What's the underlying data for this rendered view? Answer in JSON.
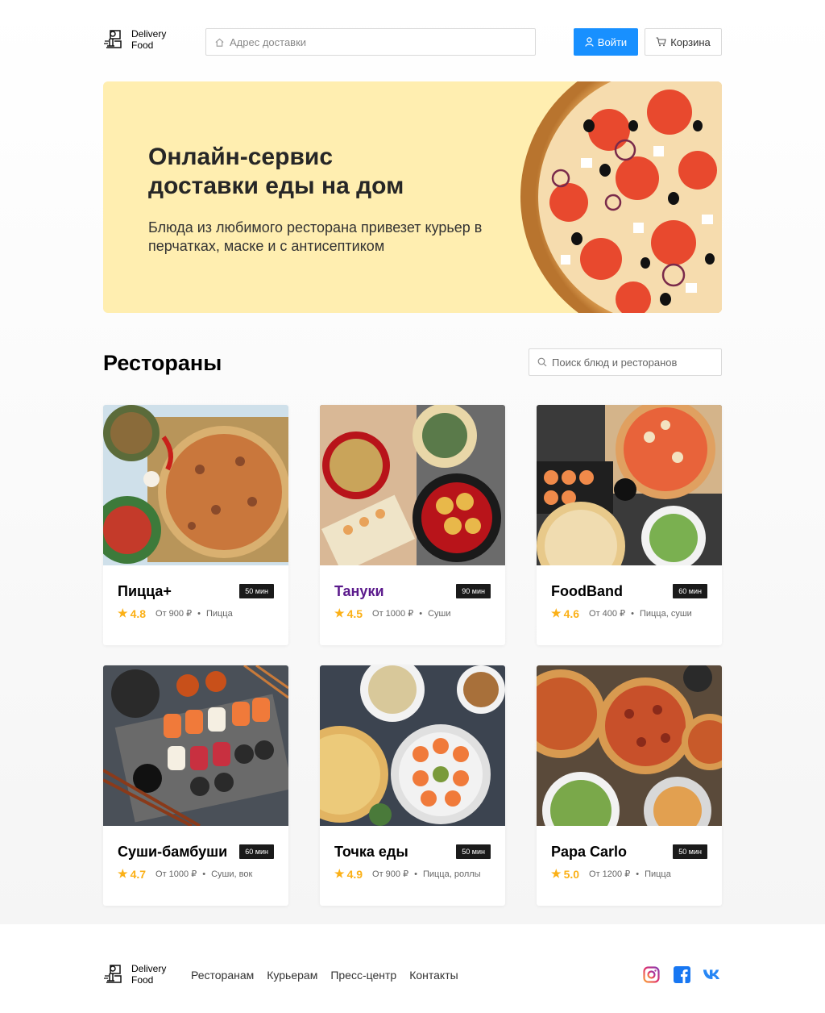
{
  "header": {
    "logo_line1": "Delivery",
    "logo_line2": "Food",
    "address_placeholder": "Адрес доставки",
    "login_label": "Войти",
    "cart_label": "Корзина"
  },
  "promo": {
    "title": "Онлайн-сервис доставки еды на дом",
    "text": "Блюда из любимого ресторана привезет курьер в перчатках, маске и с антисептиком"
  },
  "section": {
    "title": "Рестораны",
    "search_placeholder": "Поиск блюд и ресторанов"
  },
  "restaurants": [
    {
      "name": "Пицца+",
      "time": "50 мин",
      "rating": "4.8",
      "price": "От 900 ₽",
      "category": "Пицца"
    },
    {
      "name": "Тануки",
      "time": "90 мин",
      "rating": "4.5",
      "price": "От 1000 ₽",
      "category": "Суши"
    },
    {
      "name": "FoodBand",
      "time": "60 мин",
      "rating": "4.6",
      "price": "От 400 ₽",
      "category": "Пицца, суши"
    },
    {
      "name": "Суши-бамбуши",
      "time": "60 мин",
      "rating": "4.7",
      "price": "От 1000 ₽",
      "category": "Суши, вок"
    },
    {
      "name": "Точка еды",
      "time": "50 мин",
      "rating": "4.9",
      "price": "От 900 ₽",
      "category": "Пицца, роллы"
    },
    {
      "name": "Papa Carlo",
      "time": "50 мин",
      "rating": "5.0",
      "price": "От 1200 ₽",
      "category": "Пицца"
    }
  ],
  "footer": {
    "logo_line1": "Delivery",
    "logo_line2": "Food",
    "nav": [
      "Ресторанам",
      "Курьерам",
      "Пресс-центр",
      "Контакты"
    ]
  },
  "colors": {
    "accent": "#1890ff",
    "promo_bg": "#ffeeb0",
    "rating": "#fbb016",
    "highlight_name": "#5b1a8c"
  }
}
